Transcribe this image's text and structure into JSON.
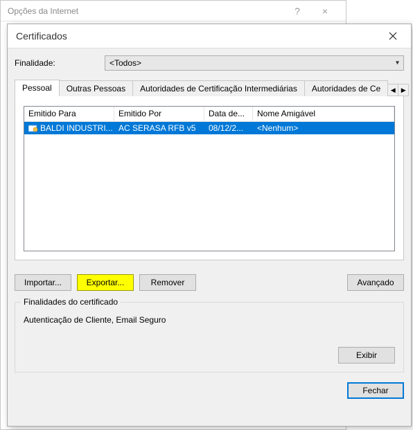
{
  "parent": {
    "title": "Opções da Internet"
  },
  "dialog": {
    "title": "Certificados",
    "purpose_label": "Finalidade:",
    "purpose_value": "<Todos>",
    "tabs": [
      "Pessoal",
      "Outras Pessoas",
      "Autoridades de Certificação Intermediárias",
      "Autoridades de Ce"
    ],
    "columns": {
      "issued_to": "Emitido Para",
      "issued_by": "Emitido Por",
      "date": "Data de...",
      "friendly": "Nome Amigável"
    },
    "rows": [
      {
        "issued_to": "BALDI INDUSTRI...",
        "issued_by": "AC SERASA RFB v5",
        "date": "08/12/2...",
        "friendly": "<Nenhum>"
      }
    ],
    "buttons": {
      "import": "Importar...",
      "export": "Exportar...",
      "remove": "Remover",
      "advanced": "Avançado"
    },
    "group": {
      "legend": "Finalidades do certificado",
      "content": "Autenticação de Cliente, Email Seguro",
      "view": "Exibir"
    },
    "close": "Fechar"
  }
}
